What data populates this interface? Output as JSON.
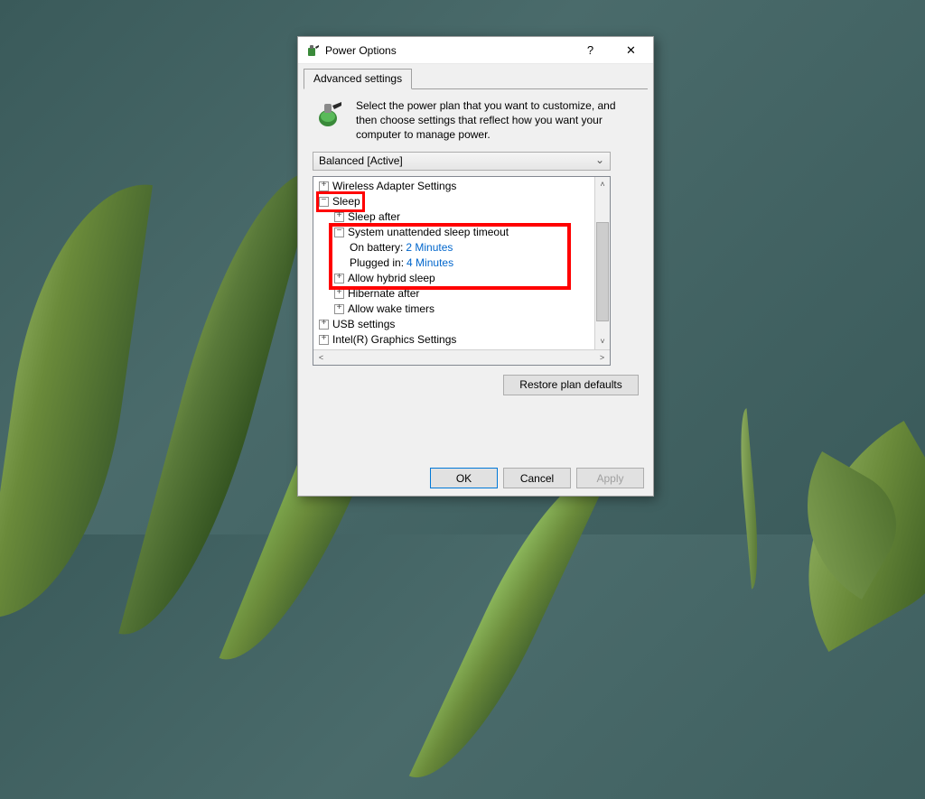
{
  "window": {
    "title": "Power Options",
    "help_icon": "?",
    "close_icon": "✕"
  },
  "tabs": {
    "advanced": "Advanced settings"
  },
  "description": "Select the power plan that you want to customize, and then choose settings that reflect how you want your computer to manage power.",
  "plan_selected": "Balanced [Active]",
  "tree": {
    "wireless": "Wireless Adapter Settings",
    "sleep": "Sleep",
    "sleep_after": "Sleep after",
    "sys_unattended": "System unattended sleep timeout",
    "on_battery_label": "On battery:",
    "on_battery_value": "2 Minutes",
    "plugged_in_label": "Plugged in:",
    "plugged_in_value": "4 Minutes",
    "allow_hybrid": "Allow hybrid sleep",
    "hibernate_after": "Hibernate after",
    "allow_wake": "Allow wake timers",
    "usb": "USB settings",
    "intel_gfx": "Intel(R) Graphics Settings"
  },
  "buttons": {
    "restore": "Restore plan defaults",
    "ok": "OK",
    "cancel": "Cancel",
    "apply": "Apply"
  },
  "expander": {
    "plus": "+",
    "minus": "−"
  }
}
